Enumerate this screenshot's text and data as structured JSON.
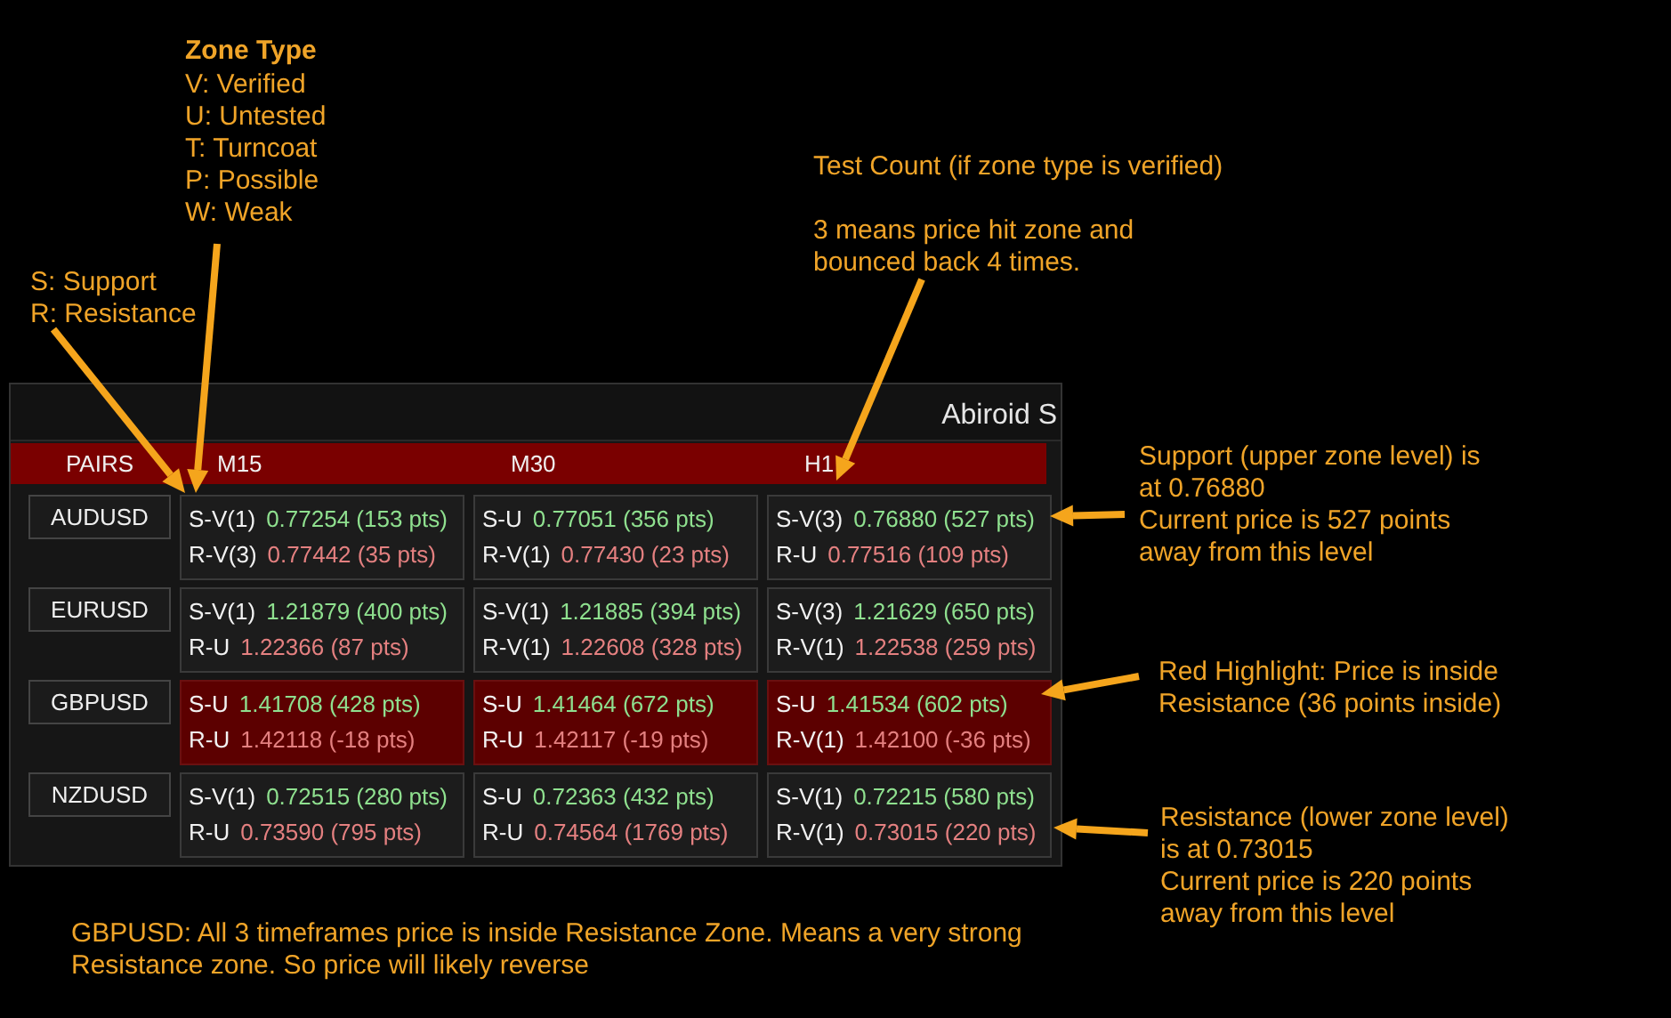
{
  "panel": {
    "title": "Abiroid S",
    "header": [
      "PAIRS",
      "M15",
      "M30",
      "H1"
    ],
    "rows": [
      {
        "pair": "AUDUSD",
        "cells": [
          {
            "highlighted": false,
            "support": {
              "label": "S-V(1)",
              "value": "0.77254 (153 pts)"
            },
            "resistance": {
              "label": "R-V(3)",
              "value": "0.77442 (35 pts)"
            }
          },
          {
            "highlighted": false,
            "support": {
              "label": "S-U",
              "value": "0.77051 (356 pts)"
            },
            "resistance": {
              "label": "R-V(1)",
              "value": "0.77430 (23 pts)"
            }
          },
          {
            "highlighted": false,
            "support": {
              "label": "S-V(3)",
              "value": "0.76880 (527 pts)"
            },
            "resistance": {
              "label": "R-U",
              "value": "0.77516 (109 pts)"
            }
          }
        ]
      },
      {
        "pair": "EURUSD",
        "cells": [
          {
            "highlighted": false,
            "support": {
              "label": "S-V(1)",
              "value": "1.21879 (400 pts)"
            },
            "resistance": {
              "label": "R-U",
              "value": "1.22366 (87 pts)"
            }
          },
          {
            "highlighted": false,
            "support": {
              "label": "S-V(1)",
              "value": "1.21885 (394 pts)"
            },
            "resistance": {
              "label": "R-V(1)",
              "value": "1.22608 (328 pts)"
            }
          },
          {
            "highlighted": false,
            "support": {
              "label": "S-V(3)",
              "value": "1.21629 (650 pts)"
            },
            "resistance": {
              "label": "R-V(1)",
              "value": "1.22538 (259 pts)"
            }
          }
        ]
      },
      {
        "pair": "GBPUSD",
        "cells": [
          {
            "highlighted": true,
            "support": {
              "label": "S-U",
              "value": "1.41708 (428 pts)"
            },
            "resistance": {
              "label": "R-U",
              "value": "1.42118 (-18 pts)"
            }
          },
          {
            "highlighted": true,
            "support": {
              "label": "S-U",
              "value": "1.41464 (672 pts)"
            },
            "resistance": {
              "label": "R-U",
              "value": "1.42117 (-19 pts)"
            }
          },
          {
            "highlighted": true,
            "support": {
              "label": "S-U",
              "value": "1.41534 (602 pts)"
            },
            "resistance": {
              "label": "R-V(1)",
              "value": "1.42100 (-36 pts)"
            }
          }
        ]
      },
      {
        "pair": "NZDUSD",
        "cells": [
          {
            "highlighted": false,
            "support": {
              "label": "S-V(1)",
              "value": "0.72515 (280 pts)"
            },
            "resistance": {
              "label": "R-U",
              "value": "0.73590 (795 pts)"
            }
          },
          {
            "highlighted": false,
            "support": {
              "label": "S-U",
              "value": "0.72363 (432 pts)"
            },
            "resistance": {
              "label": "R-U",
              "value": "0.74564 (1769 pts)"
            }
          },
          {
            "highlighted": false,
            "support": {
              "label": "S-V(1)",
              "value": "0.72215 (580 pts)"
            },
            "resistance": {
              "label": "R-V(1)",
              "value": "0.73015 (220 pts)"
            }
          }
        ]
      }
    ]
  },
  "annotations": [
    {
      "title": "Zone Type",
      "lines": [
        "V: Verified",
        "U: Untested",
        "T: Turncoat",
        "P: Possible",
        "W: Weak"
      ]
    },
    {
      "lines": [
        "S: Support",
        "R: Resistance"
      ]
    },
    {
      "lines": [
        "Test Count (if zone type is verified)"
      ]
    },
    {
      "lines": [
        "3 means price hit zone and",
        "bounced back 4 times."
      ]
    },
    {
      "lines": [
        "Support (upper zone level) is",
        "at 0.76880",
        "Current price is 527 points",
        "away from this level"
      ]
    },
    {
      "lines": [
        "Red Highlight: Price is inside",
        "Resistance (36 points inside)"
      ]
    },
    {
      "lines": [
        "Resistance (lower zone level)",
        "is at 0.73015",
        "Current price is 220 points",
        "away from this level"
      ]
    },
    {
      "lines": [
        "GBPUSD: All 3 timeframes price is inside Resistance Zone. Means a very strong",
        "Resistance zone. So price will likely reverse"
      ]
    }
  ]
}
